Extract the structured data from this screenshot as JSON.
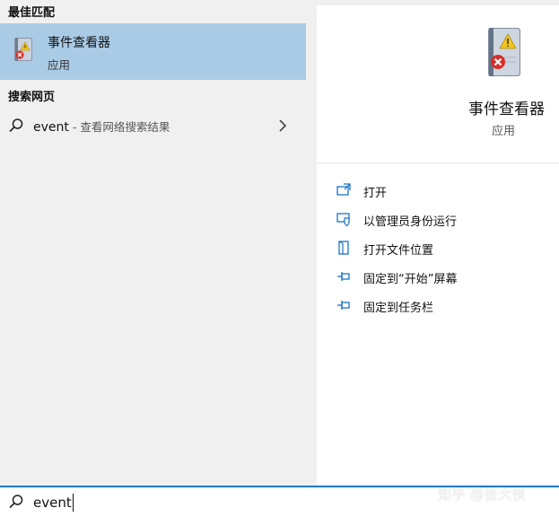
{
  "colors": {
    "selected_bg": "#aacbe6",
    "accent": "#0078d7",
    "pane_left": "#f0f0f0",
    "pane_right": "#ffffff"
  },
  "left": {
    "best_match_header": "最佳匹配",
    "best_match": {
      "icon": "event-viewer-icon",
      "title": "事件查看器",
      "subtitle": "应用"
    },
    "web_header": "搜索网页",
    "web_result": {
      "icon": "search-icon",
      "query": "event",
      "hint": " - 查看网络搜索结果",
      "chevron": "chevron-right-icon"
    }
  },
  "right": {
    "icon": "event-viewer-icon",
    "title": "事件查看器",
    "subtitle": "应用",
    "actions": [
      {
        "icon": "open-icon",
        "label": "打开"
      },
      {
        "icon": "run-as-admin-icon",
        "label": "以管理员身份运行"
      },
      {
        "icon": "open-file-location-icon",
        "label": "打开文件位置"
      },
      {
        "icon": "pin-start-icon",
        "label": "固定到“开始”屏幕"
      },
      {
        "icon": "pin-taskbar-icon",
        "label": "固定到任务栏"
      }
    ]
  },
  "searchbar": {
    "icon": "search-icon",
    "value": "event"
  },
  "watermark": "知乎 @张大侠"
}
